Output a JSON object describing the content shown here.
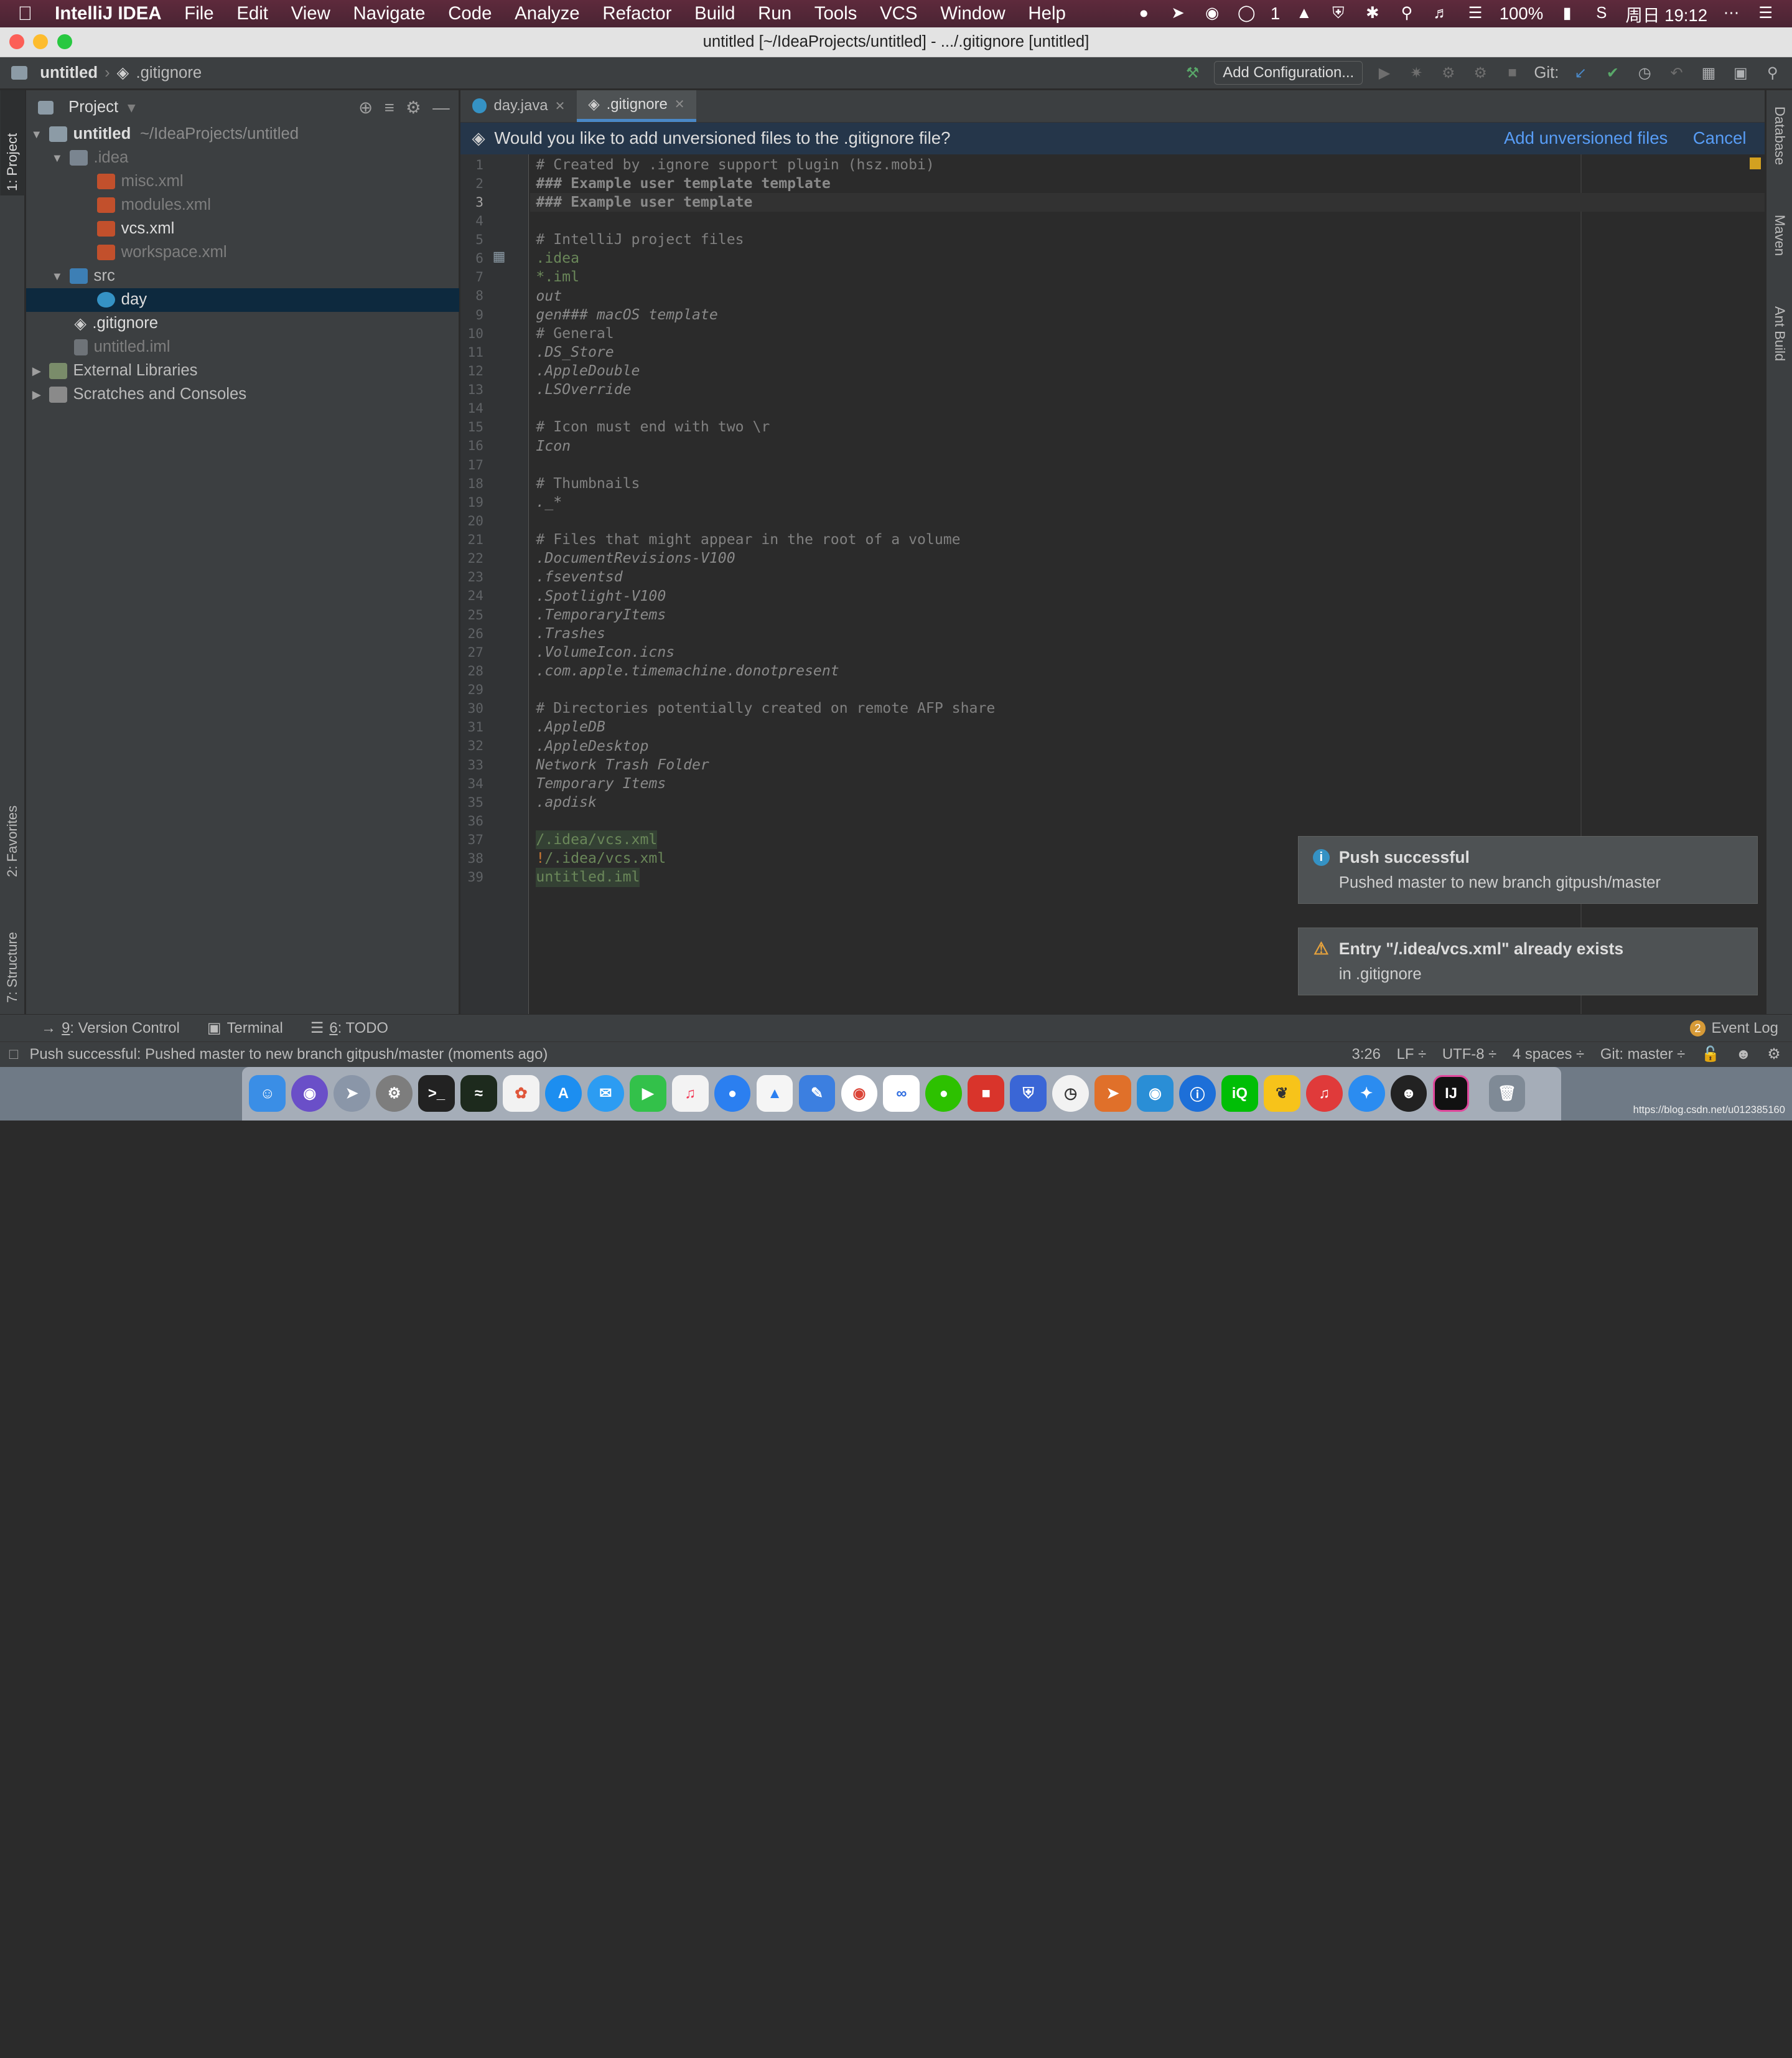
{
  "menubar": {
    "app": "IntelliJ IDEA",
    "items": [
      "File",
      "Edit",
      "View",
      "Navigate",
      "Code",
      "Analyze",
      "Refactor",
      "Build",
      "Run",
      "Tools",
      "VCS",
      "Window",
      "Help"
    ],
    "battery": "100%",
    "clock": "周日 19:12",
    "badge_count": "1"
  },
  "window": {
    "title": "untitled [~/IdeaProjects/untitled] - .../.gitignore [untitled]"
  },
  "navbar": {
    "breadcrumb_project": "untitled",
    "breadcrumb_file": ".gitignore",
    "add_config": "Add Configuration...",
    "git_label": "Git:"
  },
  "left_stripe": {
    "project": "1: Project",
    "favorites": "2: Favorites",
    "structure": "7: Structure"
  },
  "right_stripe": {
    "database": "Database",
    "maven": "Maven",
    "ant": "Ant Build"
  },
  "project_panel": {
    "title": "Project",
    "root_name": "untitled",
    "root_path": "~/IdeaProjects/untitled",
    "idea_folder": ".idea",
    "files_idea": [
      "misc.xml",
      "modules.xml",
      "vcs.xml",
      "workspace.xml"
    ],
    "src_folder": "src",
    "src_class": "day",
    "gitignore": ".gitignore",
    "iml": "untitled.iml",
    "external_libs": "External Libraries",
    "scratches": "Scratches and Consoles"
  },
  "editor": {
    "tabs": [
      {
        "label": "day.java"
      },
      {
        "label": ".gitignore"
      }
    ],
    "banner_text": "Would you like to add unversioned files to the .gitignore file?",
    "banner_add": "Add unversioned files",
    "banner_cancel": "Cancel",
    "current_line": 3,
    "lines": [
      {
        "t": "# Created by .ignore support plugin (hsz.mobi)",
        "s": "comment"
      },
      {
        "t": "### Example user template template",
        "s": "bold"
      },
      {
        "t": "### Example user template",
        "s": "bold"
      },
      {
        "t": "",
        "s": "comment"
      },
      {
        "t": "# IntelliJ project files",
        "s": "comment"
      },
      {
        "t": ".idea",
        "s": "green"
      },
      {
        "t": "*.iml",
        "s": "green"
      },
      {
        "t": "out",
        "s": "ital"
      },
      {
        "t": "gen### macOS template",
        "s": "ital"
      },
      {
        "t": "# General",
        "s": "comment"
      },
      {
        "t": ".DS_Store",
        "s": "ital"
      },
      {
        "t": ".AppleDouble",
        "s": "ital"
      },
      {
        "t": ".LSOverride",
        "s": "ital"
      },
      {
        "t": "",
        "s": "comment"
      },
      {
        "t": "# Icon must end with two \\r",
        "s": "comment"
      },
      {
        "t": "Icon",
        "s": "ital"
      },
      {
        "t": "",
        "s": "comment"
      },
      {
        "t": "# Thumbnails",
        "s": "comment"
      },
      {
        "t": "._*",
        "s": "ital"
      },
      {
        "t": "",
        "s": "comment"
      },
      {
        "t": "# Files that might appear in the root of a volume",
        "s": "comment"
      },
      {
        "t": ".DocumentRevisions-V100",
        "s": "ital"
      },
      {
        "t": ".fseventsd",
        "s": "ital"
      },
      {
        "t": ".Spotlight-V100",
        "s": "ital"
      },
      {
        "t": ".TemporaryItems",
        "s": "ital"
      },
      {
        "t": ".Trashes",
        "s": "ital"
      },
      {
        "t": ".VolumeIcon.icns",
        "s": "ital"
      },
      {
        "t": ".com.apple.timemachine.donotpresent",
        "s": "ital"
      },
      {
        "t": "",
        "s": "comment"
      },
      {
        "t": "# Directories potentially created on remote AFP share",
        "s": "comment"
      },
      {
        "t": ".AppleDB",
        "s": "ital"
      },
      {
        "t": ".AppleDesktop",
        "s": "ital"
      },
      {
        "t": "Network Trash Folder",
        "s": "ital"
      },
      {
        "t": "Temporary Items",
        "s": "ital"
      },
      {
        "t": ".apdisk",
        "s": "ital"
      },
      {
        "t": "",
        "s": "comment"
      },
      {
        "t": "/.idea/vcs.xml",
        "s": "hl"
      },
      {
        "t": "!/.idea/vcs.xml",
        "s": "neg"
      },
      {
        "t": "untitled.iml",
        "s": "hl"
      }
    ]
  },
  "notifications": [
    {
      "title": "Push successful",
      "body": "Pushed master to new branch gitpush/master",
      "kind": "info"
    },
    {
      "title": "Entry \"/.idea/vcs.xml\" already exists",
      "body": "in .gitignore",
      "kind": "warning"
    }
  ],
  "bottom_tabs": {
    "version_control_num": "9",
    "version_control": ": Version Control",
    "terminal": "Terminal",
    "todo_num": "6",
    "todo": ": TODO",
    "event_log": "Event Log",
    "event_count": "2"
  },
  "status": {
    "message": "Push successful: Pushed master to new branch gitpush/master (moments ago)",
    "position": "3:26",
    "line_sep": "LF ÷",
    "encoding": "UTF-8 ÷",
    "indent": "4 spaces ÷",
    "git_branch": "Git: master ÷"
  },
  "dock": {
    "url": "https://blog.csdn.net/u012385160"
  },
  "colors": {
    "accent": "#4a88c7",
    "link": "#589df6",
    "bg": "#2b2b2b",
    "panel": "#3c3f41"
  }
}
